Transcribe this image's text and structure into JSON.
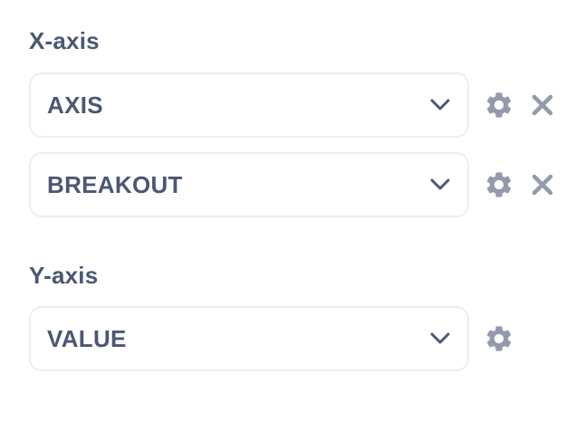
{
  "x_axis": {
    "title": "X-axis",
    "fields": [
      {
        "value": "AXIS",
        "icon_settings": "gear-icon",
        "icon_remove": "close-icon"
      },
      {
        "value": "BREAKOUT",
        "icon_settings": "gear-icon",
        "icon_remove": "close-icon"
      }
    ]
  },
  "y_axis": {
    "title": "Y-axis",
    "fields": [
      {
        "value": "VALUE",
        "icon_settings": "gear-icon"
      }
    ]
  },
  "colors": {
    "text": "#4c5773",
    "icon": "#949aab",
    "border": "#eeeef0"
  }
}
